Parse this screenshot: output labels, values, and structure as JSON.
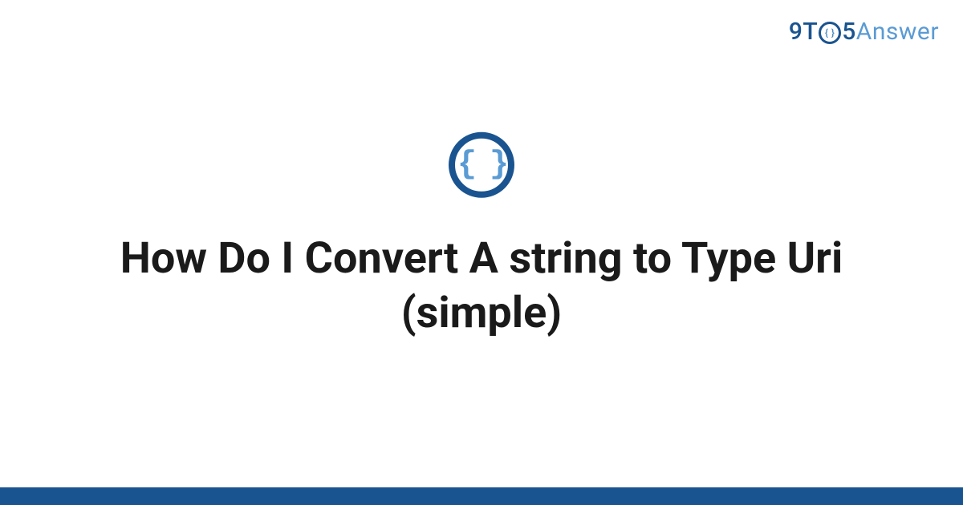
{
  "logo": {
    "part_9t": "9T",
    "part_o_inner": "{ }",
    "part_5": "5",
    "part_answer": "Answer"
  },
  "badge": {
    "icon_name": "code-braces-icon",
    "glyph": "{ }"
  },
  "title": "How Do I Convert A string to Type Uri (simple)",
  "colors": {
    "brand_dark": "#1a5490",
    "brand_light": "#5a9bd4",
    "text": "#1a1a1a"
  }
}
